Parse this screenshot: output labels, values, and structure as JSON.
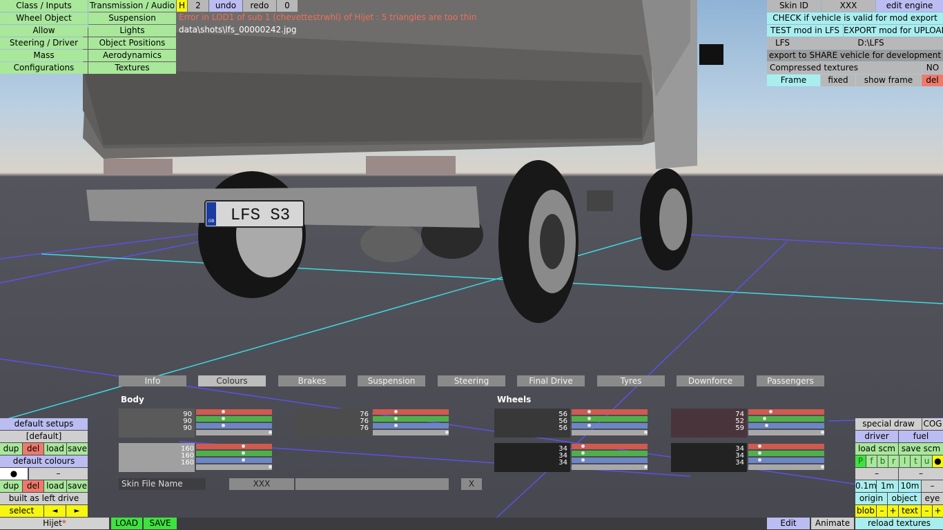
{
  "menu_left": {
    "class_inputs": "Class / Inputs",
    "transmission": "Transmission / Audio",
    "wheel_object": "Wheel Object",
    "suspension": "Suspension",
    "allow": "Allow",
    "lights": "Lights",
    "steering": "Steering / Driver",
    "object_positions": "Object Positions",
    "mass": "Mass",
    "aerodynamics": "Aerodynamics",
    "configurations": "Configurations",
    "textures": "Textures"
  },
  "top_tools": {
    "h": "H",
    "count": "2",
    "undo": "undo",
    "redo": "redo",
    "zero": "0"
  },
  "messages": {
    "error": "Error in LOD1 of sub 1 (chevettestrwhl) of Hijet : 5 triangles are too thin",
    "path": "data\\shots\\lfs_00000242.jpg"
  },
  "menu_right": {
    "skin_id": "Skin ID",
    "skin_val": "XXX",
    "edit_engine": "edit engine",
    "check": "CHECK if vehicle is valid for mod export",
    "test": "TEST mod in LFS",
    "export": "EXPORT mod for UPLOAD",
    "lfs": "LFS",
    "path": "D:\\LFS",
    "share": "export to SHARE vehicle for development",
    "compressed": "Compressed textures",
    "compressed_val": "NO",
    "frame": "Frame",
    "fixed": "fixed",
    "show_frame": "show frame",
    "del": "del"
  },
  "tabs": [
    "Info",
    "Colours",
    "Brakes",
    "Suspension",
    "Steering",
    "Final Drive",
    "Tyres",
    "Downforce",
    "Passengers"
  ],
  "colours": {
    "body_label": "Body",
    "wheels_label": "Wheels",
    "body1": [
      "90",
      "90",
      "90"
    ],
    "body2": [
      "76",
      "76",
      "76"
    ],
    "body3": [
      "160",
      "160",
      "160"
    ],
    "wheel1": [
      "56",
      "56",
      "56"
    ],
    "wheel2": [
      "74",
      "52",
      "59"
    ],
    "wheel3": [
      "34",
      "34",
      "34"
    ],
    "wheel4": [
      "34",
      "34",
      "34"
    ],
    "skin_file_name": "Skin File Name",
    "skin_file_val": "XXX",
    "x": "X",
    "swatch_colors": {
      "body1": "#5a5a5a",
      "body2": "#4c4c4c",
      "body3": "#a0a0a0",
      "wheel1": "#383838",
      "wheel2": "#4a343b",
      "wheel3": "#222222",
      "wheel4": "#222222"
    }
  },
  "left_bottom": {
    "default_setups": "default setups",
    "default_name": "[default]",
    "dup": "dup",
    "del": "del",
    "load": "load",
    "save": "save",
    "default_colours": "default colours",
    "dot": "●",
    "dash": "–",
    "built": "built as left drive",
    "select": "select",
    "left_arrow": "◄",
    "right_arrow": "►"
  },
  "status_bar": {
    "vehicle": "Hijet",
    "star": "*",
    "load": "LOAD",
    "save": "SAVE",
    "edit": "Edit",
    "animate": "Animate",
    "reload": "reload textures"
  },
  "right_bottom": {
    "special_draw": "special draw",
    "cog": "COG",
    "driver": "driver",
    "fuel": "fuel",
    "load_scm": "load scm",
    "save_scm": "save scm",
    "flags": [
      "P",
      "f",
      "b",
      "r",
      "l",
      "t",
      "u",
      "●"
    ],
    "dash": "–",
    "d01": "0.1m",
    "d1": "1m",
    "d10": "10m",
    "origin": "origin",
    "object": "object",
    "eye": "eye",
    "blob": "blob",
    "minus": "–",
    "plus": "+",
    "text": "text"
  },
  "plate": "LFS S3",
  "plate_country": "GB"
}
